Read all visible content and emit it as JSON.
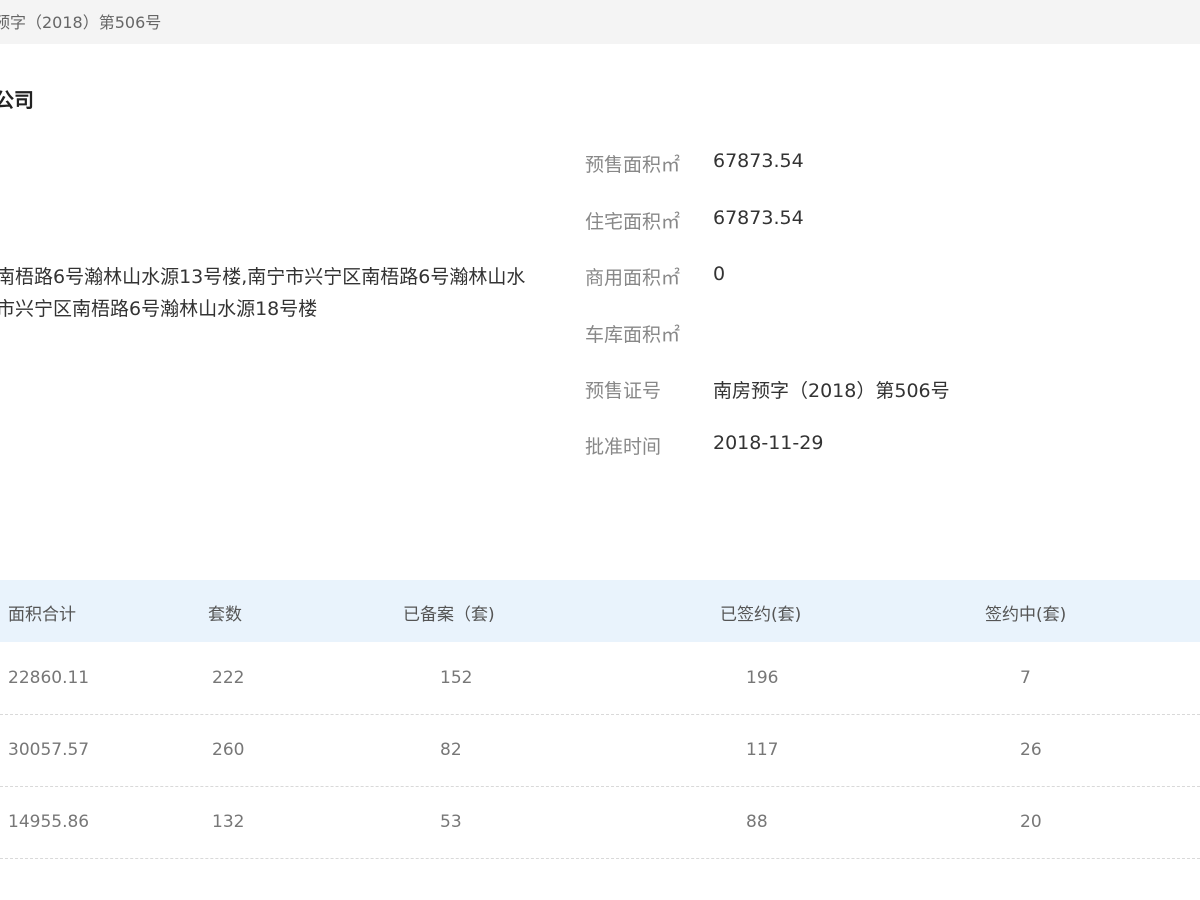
{
  "top_bar": {
    "crumb": "预字（2018）第506号"
  },
  "company": {
    "title_fragment": "公司"
  },
  "address": {
    "line1": "南梧路6号瀚林山水源13号楼,南宁市兴宁区南梧路6号瀚林山水",
    "line2": "市兴宁区南梧路6号瀚林山水源18号楼"
  },
  "info": [
    {
      "label": "预售面积㎡",
      "value": "67873.54"
    },
    {
      "label": "住宅面积㎡",
      "value": "67873.54"
    },
    {
      "label": "商用面积㎡",
      "value": "0"
    },
    {
      "label": "车库面积㎡",
      "value": ""
    },
    {
      "label": "预售证号",
      "value": "南房预字（2018）第506号"
    },
    {
      "label": "批准时间",
      "value": "2018-11-29"
    }
  ],
  "table": {
    "headers": [
      "面积合计",
      "套数",
      "已备案（套)",
      "已签约(套)",
      "签约中(套)"
    ],
    "rows": [
      [
        "22860.11",
        "222",
        "152",
        "196",
        "7"
      ],
      [
        "30057.57",
        "260",
        "82",
        "117",
        "26"
      ],
      [
        "14955.86",
        "132",
        "53",
        "88",
        "20"
      ]
    ]
  }
}
